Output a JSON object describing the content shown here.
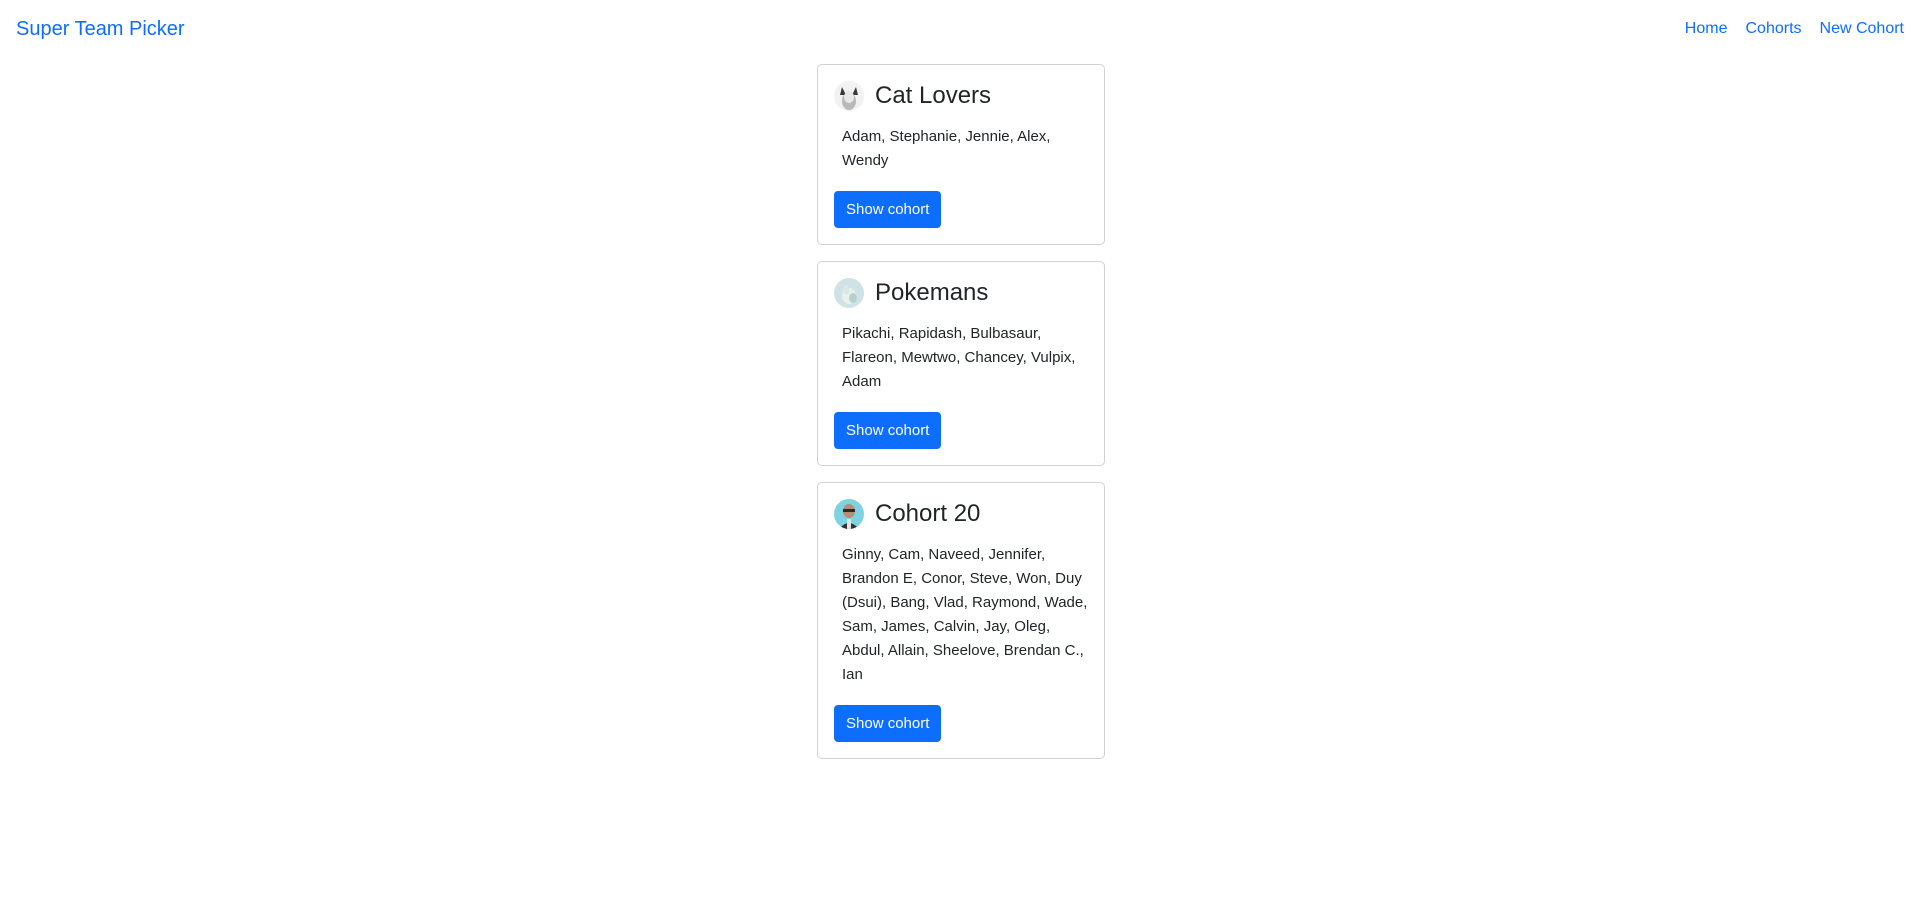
{
  "nav": {
    "brand": "Super Team Picker",
    "links": [
      "Home",
      "Cohorts",
      "New Cohort"
    ]
  },
  "cohorts": [
    {
      "name": "Cat Lovers",
      "members": "Adam, Stephanie, Jennie, Alex, Wendy",
      "button": "Show cohort",
      "avatar": "cat-avatar"
    },
    {
      "name": "Pokemans",
      "members": "Pikachi, Rapidash, Bulbasaur, Flareon, Mewtwo, Chancey, Vulpix, Adam",
      "button": "Show cohort",
      "avatar": "pokemon-avatar"
    },
    {
      "name": "Cohort 20",
      "members": "Ginny, Cam, Naveed, Jennifer, Brandon E, Conor, Steve, Won, Duy (Dsui), Bang, Vlad, Raymond, Wade, Sam, James, Calvin, Jay, Oleg, Abdul, Allain, Sheelove, Brendan C., Ian",
      "button": "Show cohort",
      "avatar": "person-avatar"
    }
  ],
  "colors": {
    "link": "#0d6efd",
    "button": "#0d6efd",
    "text": "#212529"
  }
}
